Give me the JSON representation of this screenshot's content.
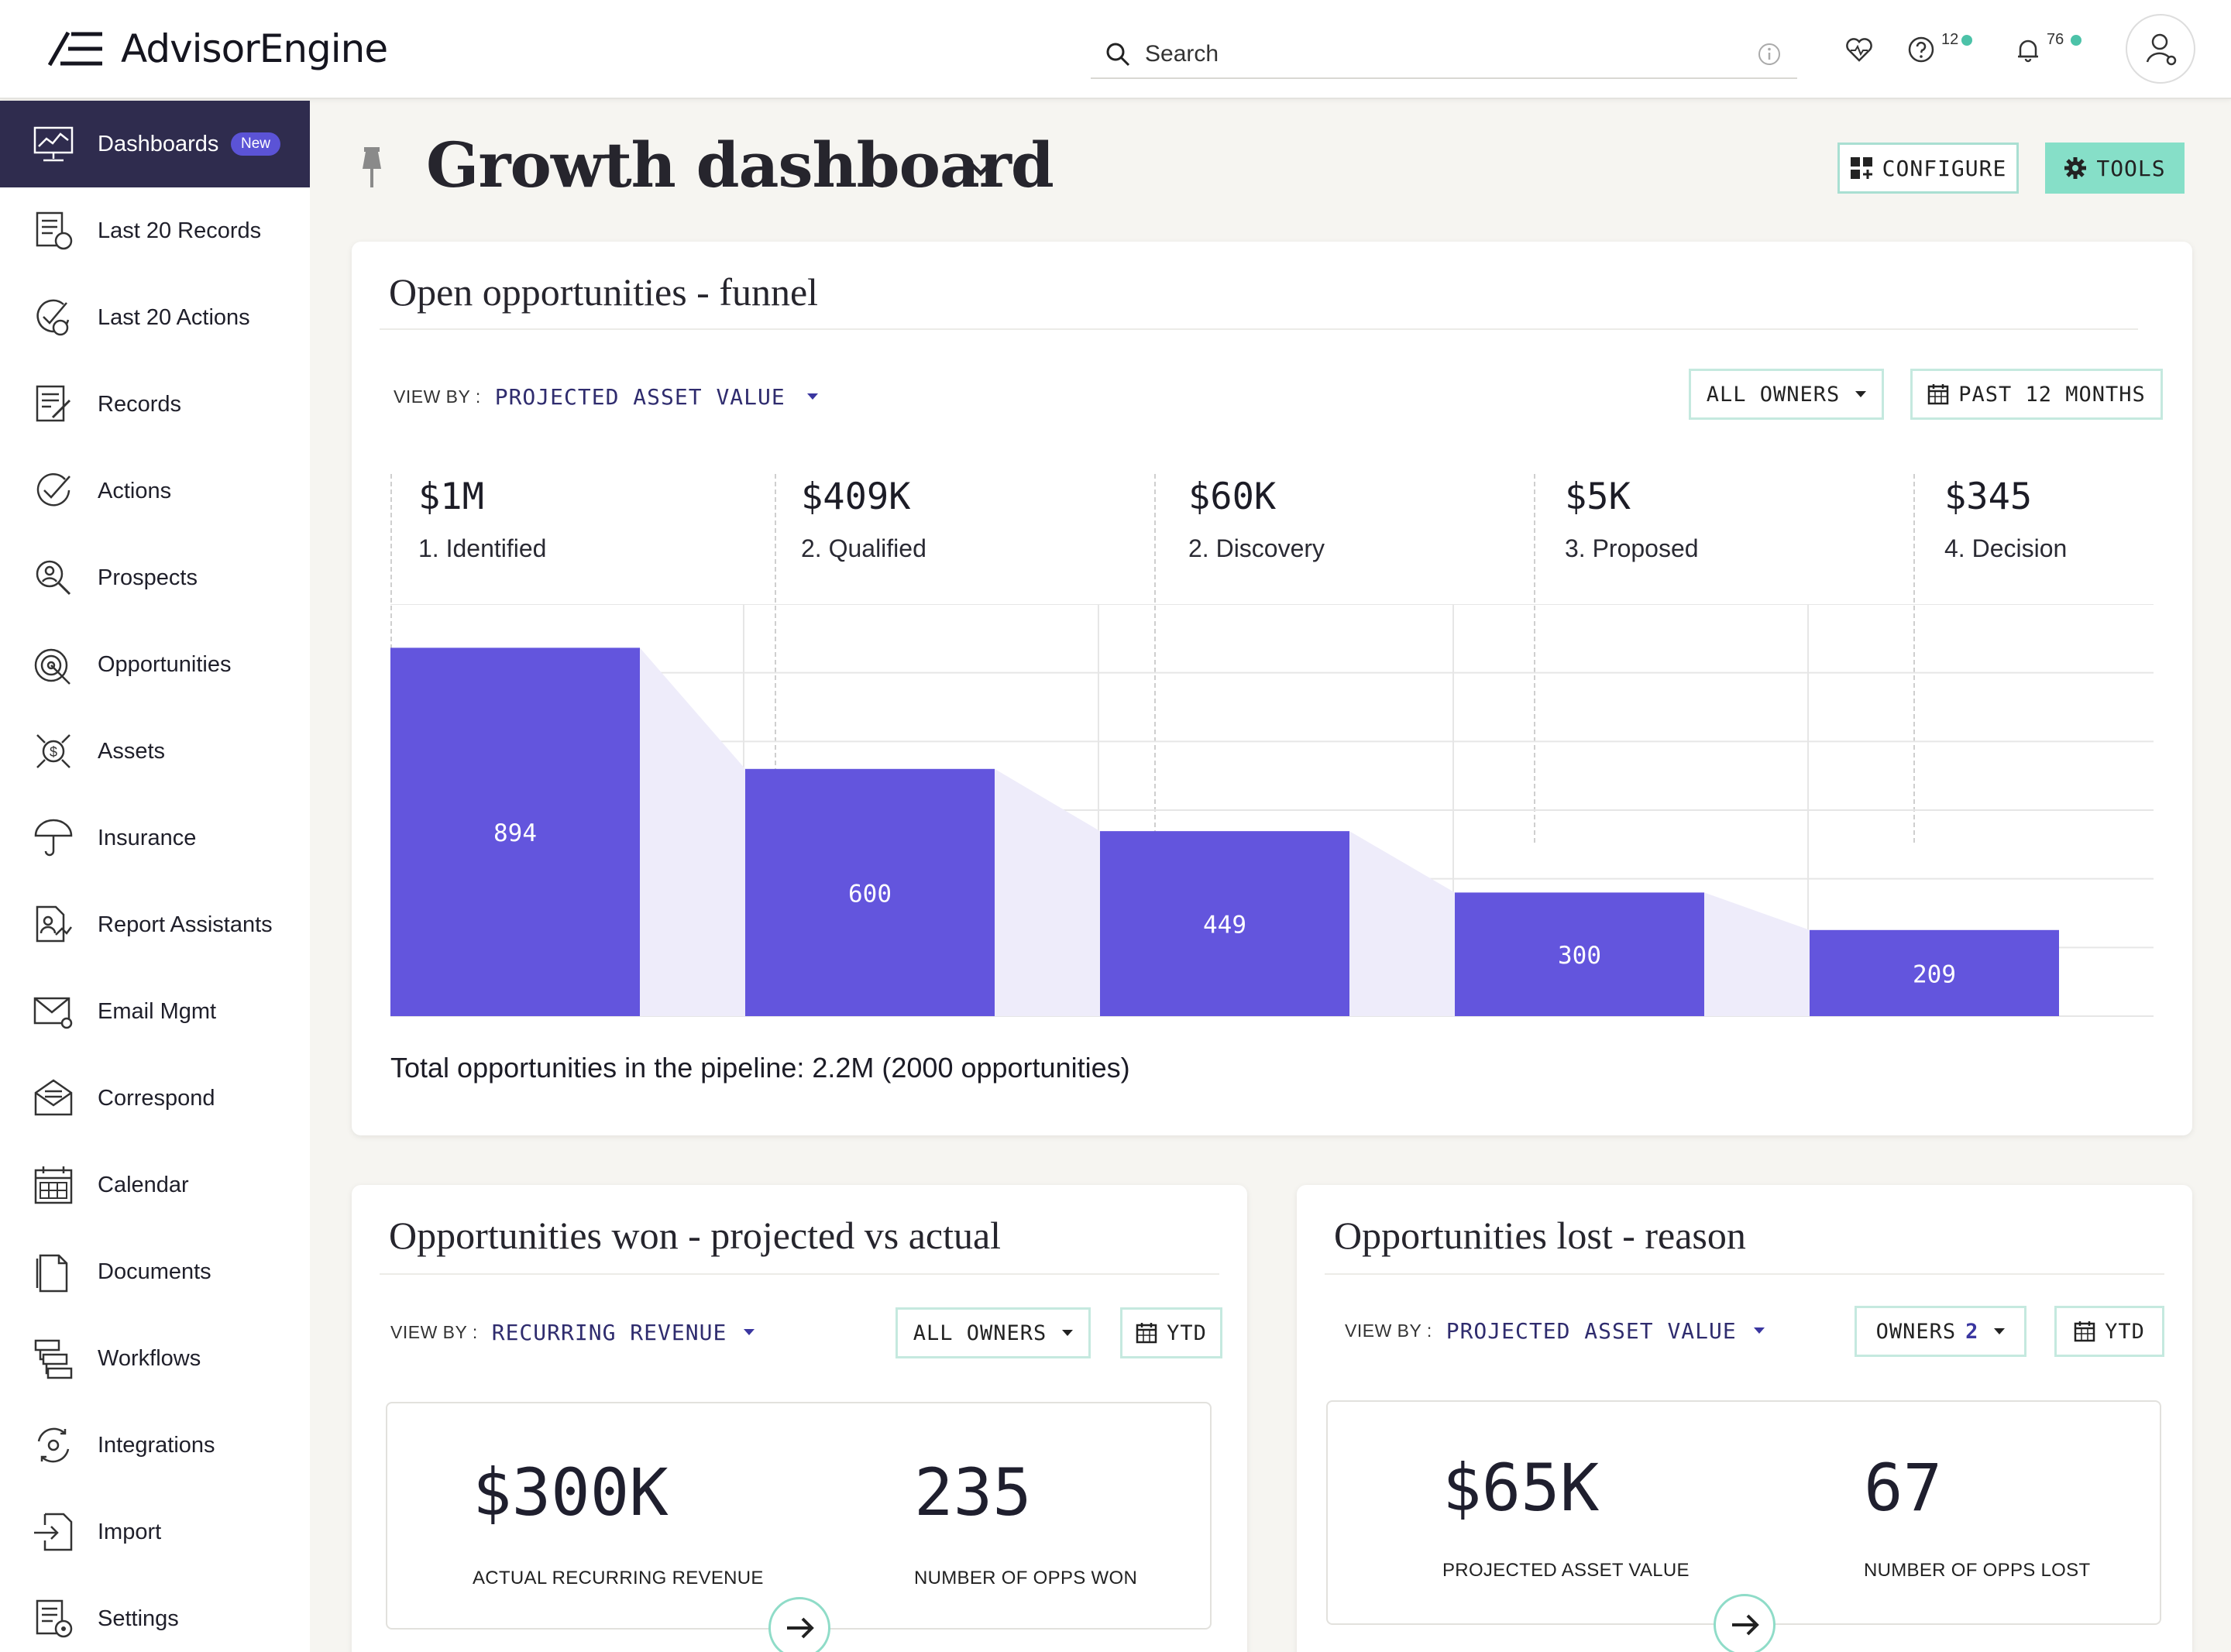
{
  "app": {
    "brand": "AdvisorEngine",
    "search_placeholder": "Search",
    "help_count": "12",
    "notifications_count": "76",
    "accent_color": "#5b53d6",
    "teal_color": "#86dfc8"
  },
  "sidebar": {
    "items": [
      {
        "label": "Dashboards",
        "icon": "dashboard-icon",
        "active": true,
        "badge": "New"
      },
      {
        "label": "Last 20 Records",
        "icon": "records-list-icon"
      },
      {
        "label": "Last 20 Actions",
        "icon": "actions-history-icon"
      },
      {
        "label": "Records",
        "icon": "records-edit-icon"
      },
      {
        "label": "Actions",
        "icon": "checkmark-icon"
      },
      {
        "label": "Prospects",
        "icon": "prospects-search-icon"
      },
      {
        "label": "Opportunities",
        "icon": "target-icon"
      },
      {
        "label": "Assets",
        "icon": "assets-dollar-icon"
      },
      {
        "label": "Insurance",
        "icon": "umbrella-icon"
      },
      {
        "label": "Report Assistants",
        "icon": "report-icon"
      },
      {
        "label": "Email Mgmt",
        "icon": "email-icon"
      },
      {
        "label": "Correspond",
        "icon": "correspond-icon"
      },
      {
        "label": "Calendar",
        "icon": "calendar-icon"
      },
      {
        "label": "Documents",
        "icon": "documents-icon"
      },
      {
        "label": "Workflows",
        "icon": "workflows-icon"
      },
      {
        "label": "Integrations",
        "icon": "integrations-icon"
      },
      {
        "label": "Import",
        "icon": "import-icon"
      },
      {
        "label": "Settings",
        "icon": "settings-icon"
      }
    ]
  },
  "header": {
    "title": "Growth dashboard",
    "configure_label": "CONFIGURE",
    "tools_label": "TOOLS"
  },
  "funnel_card": {
    "title": "Open opportunities - funnel",
    "viewby_label": "VIEW BY :",
    "viewby_value": "PROJECTED ASSET VALUE",
    "owners_label": "ALL OWNERS",
    "period_label": "PAST 12 MONTHS",
    "stages": [
      {
        "value": "$1M",
        "label": "1. Identified"
      },
      {
        "value": "$409K",
        "label": "2. Qualified"
      },
      {
        "value": "$60K",
        "label": "2. Discovery"
      },
      {
        "value": "$5K",
        "label": "3. Proposed"
      },
      {
        "value": "$345",
        "label": "4. Decision"
      }
    ],
    "total": "Total opportunities in the pipeline: 2.2M (2000 opportunities)"
  },
  "chart_data": {
    "type": "bar",
    "categories": [
      "1. Identified",
      "2. Qualified",
      "2. Discovery",
      "3. Proposed",
      "4. Decision"
    ],
    "values": [
      894,
      600,
      449,
      300,
      209
    ],
    "ylim": [
      0,
      1000
    ],
    "grid": true,
    "bar_color": "#6355dd",
    "connector_color": "#eeecfa"
  },
  "won_card": {
    "title": "Opportunities won - projected vs actual",
    "viewby_label": "VIEW BY :",
    "viewby_value": "RECURRING REVENUE",
    "owners_label": "ALL OWNERS",
    "period_label": "YTD",
    "stat1_value": "$300K",
    "stat1_label": "ACTUAL RECURRING REVENUE",
    "stat2_value": "235",
    "stat2_label": "NUMBER OF OPPS WON"
  },
  "lost_card": {
    "title": "Opportunities lost - reason",
    "viewby_label": "VIEW BY :",
    "viewby_value": "PROJECTED ASSET VALUE",
    "owners_label": "OWNERS",
    "owners_count": "2",
    "period_label": "YTD",
    "stat1_value": "$65K",
    "stat1_label": "PROJECTED ASSET VALUE",
    "stat2_value": "67",
    "stat2_label": "NUMBER OF OPPS LOST"
  }
}
